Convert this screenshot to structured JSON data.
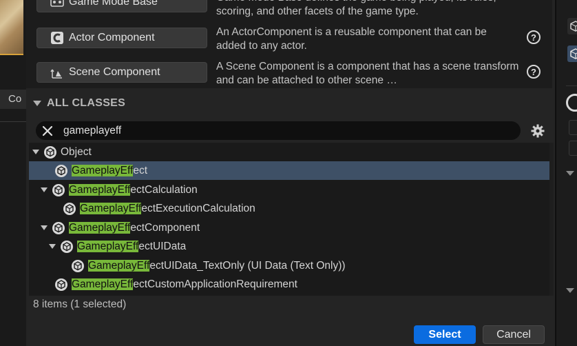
{
  "colors": {
    "accent": "#0b6ce0",
    "highlight": "#78b83a",
    "selected_row": "#3e5066",
    "panel": "#242424"
  },
  "background": {
    "left_label": "Co"
  },
  "common_classes": [
    {
      "label": "Game Mode Base",
      "icon": "game-mode-icon",
      "description": "Game Mode Base defines the game being played, its rules, scoring, and other facets of the game type."
    },
    {
      "label": "Actor Component",
      "icon": "actor-component-icon",
      "description": "An ActorComponent is a reusable component that can be added to any actor."
    },
    {
      "label": "Scene Component",
      "icon": "scene-component-icon",
      "description": "A Scene Component is a component that has a scene transform and can be attached to other scene …"
    }
  ],
  "all_classes": {
    "header": "ALL CLASSES",
    "search_value": "gameplayeff",
    "tree": [
      {
        "highlight": "",
        "rest": "Object",
        "expanded": true
      },
      {
        "highlight": "GameplayEff",
        "rest": "ect",
        "expanded": false,
        "selected": true
      },
      {
        "highlight": "GameplayEff",
        "rest": "ectCalculation",
        "expanded": true
      },
      {
        "highlight": "GameplayEff",
        "rest": "ectExecutionCalculation",
        "expanded": false
      },
      {
        "highlight": "GameplayEff",
        "rest": "ectComponent",
        "expanded": true
      },
      {
        "highlight": "GameplayEff",
        "rest": "ectUIData",
        "expanded": true
      },
      {
        "highlight": "GameplayEff",
        "rest": "ectUIData_TextOnly (UI Data (Text Only))",
        "expanded": false
      },
      {
        "highlight": "GameplayEff",
        "rest": "ectCustomApplicationRequirement",
        "expanded": false
      }
    ],
    "status": "8 items (1 selected)"
  },
  "buttons": {
    "select": "Select",
    "cancel": "Cancel"
  }
}
